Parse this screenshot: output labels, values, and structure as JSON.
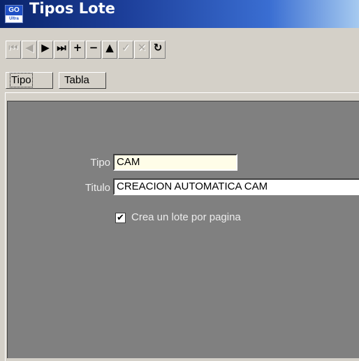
{
  "window": {
    "title": "Tipos Lote",
    "icon": "app-logo-icon",
    "icon_top_text": "GO",
    "icon_bottom_text": "Ultra"
  },
  "toolbar": {
    "buttons": [
      {
        "name": "first-record-button",
        "glyph": "⏮",
        "enabled": false
      },
      {
        "name": "prior-record-button",
        "glyph": "◀",
        "enabled": false
      },
      {
        "name": "next-record-button",
        "glyph": "▶",
        "enabled": true
      },
      {
        "name": "last-record-button",
        "glyph": "⏭",
        "enabled": true
      },
      {
        "name": "insert-record-button",
        "glyph": "+",
        "enabled": true
      },
      {
        "name": "delete-record-button",
        "glyph": "−",
        "enabled": true
      },
      {
        "name": "edit-record-button",
        "glyph": "▲",
        "enabled": true
      },
      {
        "name": "post-edit-button",
        "glyph": "✓",
        "enabled": false
      },
      {
        "name": "cancel-edit-button",
        "glyph": "✕",
        "enabled": false
      },
      {
        "name": "refresh-button",
        "glyph": "↻",
        "enabled": true
      }
    ]
  },
  "tabs": [
    {
      "label": "Tipo",
      "active": true
    },
    {
      "label": "Tabla",
      "active": false
    }
  ],
  "form": {
    "tipo_label": "Tipo",
    "tipo_value": "CAM",
    "titulo_label": "Titulo",
    "titulo_value": "CREACION AUTOMATICA CAM",
    "checkbox_label": "Crea un lote por pagina",
    "checkbox_checked": true,
    "checkbox_glyph": "✔"
  },
  "colors": {
    "panel": "#808080",
    "tipo_field": "#fffde8",
    "titulo_field": "#ffffff"
  }
}
